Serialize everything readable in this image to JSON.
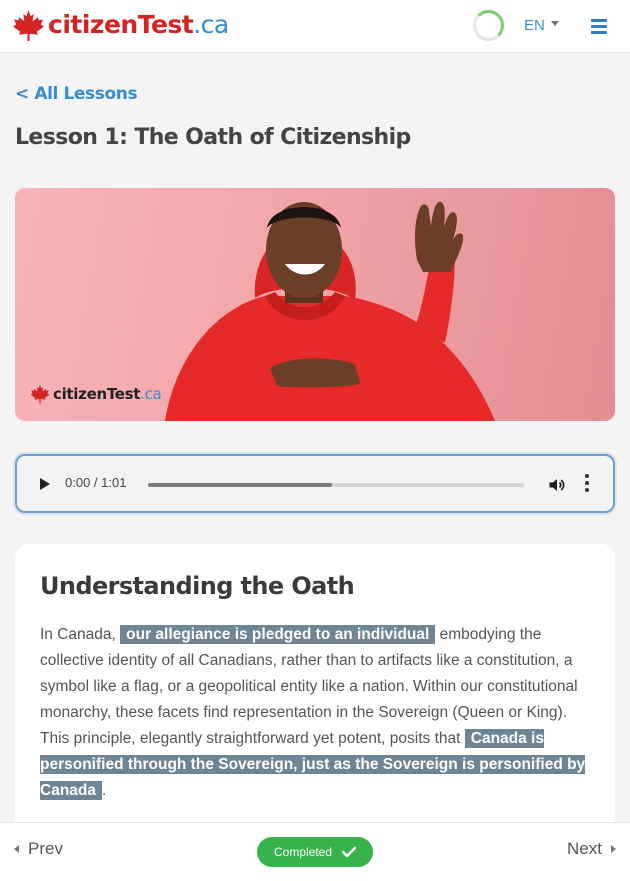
{
  "header": {
    "logo_main": "citizenTest",
    "logo_sub": ".ca",
    "language": "EN"
  },
  "nav": {
    "back_label": "< All Lessons"
  },
  "lesson": {
    "title": "Lesson 1: The Oath of Citizenship"
  },
  "hero": {
    "watermark_main": "citizenTest",
    "watermark_sub": ".ca"
  },
  "audio": {
    "time_label": "0:00 / 1:01",
    "progress": 0.49
  },
  "card": {
    "heading": "Understanding the Oath",
    "p_before_1": "In Canada, ",
    "highlight_1": "our allegiance is pledged to an individual",
    "p_mid": " embodying the collective identity of all Canadians, rather than to artifacts like a constitution, a symbol like a flag, or a geopolitical entity like a nation. Within our constitutional monarchy, these facets find representation in the Sovereign (Queen or King). This principle, elegantly straightforward yet potent, posits that ",
    "highlight_2": "Canada is personified through the Sovereign, just as the Sovereign is personified by Canada",
    "p_end": "."
  },
  "footer": {
    "prev_label": "Prev",
    "next_label": "Next",
    "completed_label": "Completed"
  },
  "colors": {
    "brand_red": "#d32323",
    "brand_blue": "#2f8fcf",
    "link_blue": "#3a8cd2",
    "completed_green": "#36b34a",
    "highlight_bg": "#6f8596"
  }
}
